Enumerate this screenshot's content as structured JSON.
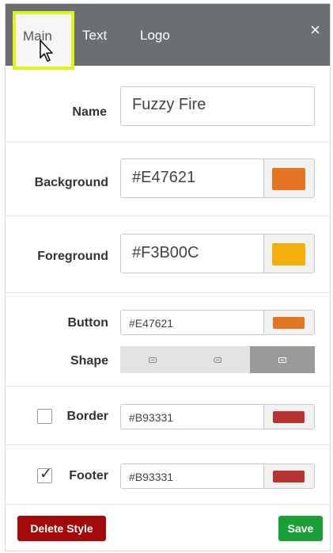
{
  "tabs": [
    {
      "label": "Main",
      "active": true
    },
    {
      "label": "Text",
      "active": false
    },
    {
      "label": "Logo",
      "active": false
    }
  ],
  "close_icon": "close-icon",
  "close_glyph": "×",
  "name": {
    "label": "Name",
    "value": "Fuzzy Fire"
  },
  "background": {
    "label": "Background",
    "value": "#E47621",
    "swatch_color": "#E47621"
  },
  "foreground": {
    "label": "Foreground",
    "value": "#F3B00C",
    "swatch_color": "#F3B00C"
  },
  "button": {
    "label": "Button",
    "value": "#E47621",
    "swatch_color": "#E47621"
  },
  "shape": {
    "label": "Shape",
    "options": [
      "rounded-rect",
      "round",
      "square"
    ],
    "selected_index": 2
  },
  "border": {
    "label": "Border",
    "checked": false,
    "value": "#B93331",
    "swatch_color": "#B93331"
  },
  "footer": {
    "label": "Footer",
    "checked": true,
    "check_glyph": "✓",
    "value": "#B93331",
    "swatch_color": "#B93331"
  },
  "actions": {
    "delete_label": "Delete Style",
    "save_label": "Save"
  },
  "colors": {
    "tabbar": "#6b6f73",
    "highlight": "#ddf51a",
    "delete": "#a30b0b",
    "save": "#1a9f38"
  }
}
